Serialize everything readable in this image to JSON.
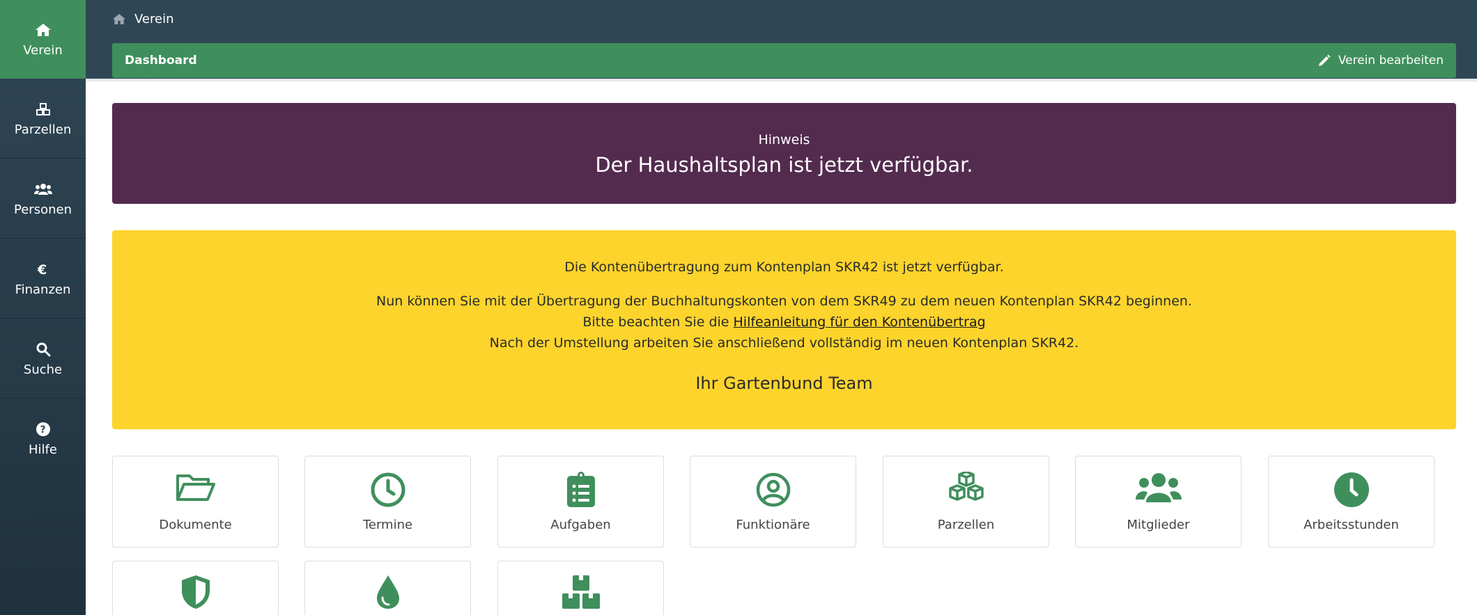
{
  "colors": {
    "primary_green": "#3f8f5c",
    "sidebar_bg": "#2f4655",
    "notice_bg": "#532b4f",
    "info_bg": "#fdd42c"
  },
  "sidebar": {
    "items": [
      {
        "label": "Verein",
        "icon": "home-icon"
      },
      {
        "label": "Parzellen",
        "icon": "cubes-icon"
      },
      {
        "label": "Personen",
        "icon": "users-icon"
      },
      {
        "label": "Finanzen",
        "icon": "euro-icon"
      },
      {
        "label": "Suche",
        "icon": "search-icon"
      },
      {
        "label": "Hilfe",
        "icon": "question-icon"
      }
    ]
  },
  "breadcrumb": {
    "label": "Verein",
    "icon": "home-icon"
  },
  "subbar": {
    "title": "Dashboard",
    "edit_label": "Verein bearbeiten",
    "edit_icon": "pencil-icon"
  },
  "notice": {
    "heading": "Hinweis",
    "message": "Der Haushaltsplan ist jetzt verfügbar."
  },
  "info": {
    "line1": "Die Kontenübertragung zum Kontenplan SKR42 ist jetzt verfügbar.",
    "line2": "Nun können Sie mit der Übertragung der Buchhaltungskonten von dem SKR49 zu dem neuen Kontenplan SKR42 beginnen.",
    "line3_prefix": "Bitte beachten Sie die ",
    "line3_link": "Hilfeanleitung für den Kontenübertrag",
    "line4": "Nach der Umstellung arbeiten Sie anschließend vollständig im neuen Kontenplan SKR42.",
    "signature": "Ihr Gartenbund Team"
  },
  "tiles": [
    {
      "label": "Dokumente",
      "icon": "folder-open-icon"
    },
    {
      "label": "Termine",
      "icon": "clock-outline-icon"
    },
    {
      "label": "Aufgaben",
      "icon": "clipboard-list-icon"
    },
    {
      "label": "Funktionäre",
      "icon": "user-circle-icon"
    },
    {
      "label": "Parzellen",
      "icon": "cubes-icon"
    },
    {
      "label": "Mitglieder",
      "icon": "users-icon"
    },
    {
      "label": "Arbeitsstunden",
      "icon": "clock-solid-icon"
    },
    {
      "label": "",
      "icon": "shield-icon"
    },
    {
      "label": "",
      "icon": "water-drop-icon"
    },
    {
      "label": "",
      "icon": "boxes-icon"
    }
  ]
}
